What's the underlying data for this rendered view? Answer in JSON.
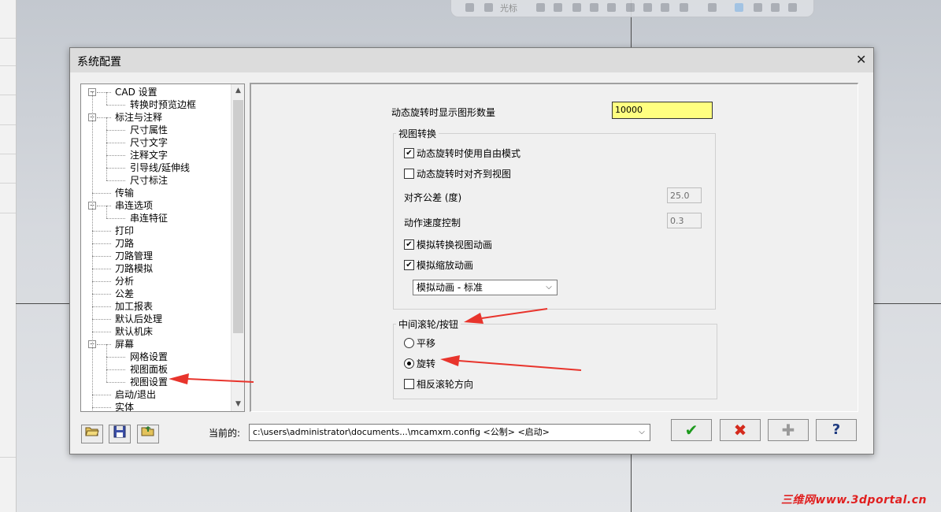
{
  "dialog": {
    "title": "系统配置",
    "close_symbol": "✕"
  },
  "tree": {
    "items": [
      {
        "label": "CAD 设置",
        "level": 0,
        "expander": "−"
      },
      {
        "label": "转换时预览边框",
        "level": 1
      },
      {
        "label": "标注与注释",
        "level": 0,
        "expander": "−"
      },
      {
        "label": "尺寸属性",
        "level": 1
      },
      {
        "label": "尺寸文字",
        "level": 1
      },
      {
        "label": "注释文字",
        "level": 1
      },
      {
        "label": "引导线/延伸线",
        "level": 1
      },
      {
        "label": "尺寸标注",
        "level": 1
      },
      {
        "label": "传输",
        "level": 0
      },
      {
        "label": "串连选项",
        "level": 0,
        "expander": "−"
      },
      {
        "label": "串连特征",
        "level": 1
      },
      {
        "label": "打印",
        "level": 0
      },
      {
        "label": "刀路",
        "level": 0
      },
      {
        "label": "刀路管理",
        "level": 0
      },
      {
        "label": "刀路模拟",
        "level": 0
      },
      {
        "label": "分析",
        "level": 0
      },
      {
        "label": "公差",
        "level": 0
      },
      {
        "label": "加工报表",
        "level": 0
      },
      {
        "label": "默认后处理",
        "level": 0
      },
      {
        "label": "默认机床",
        "level": 0
      },
      {
        "label": "屏幕",
        "level": 0,
        "expander": "−"
      },
      {
        "label": "网格设置",
        "level": 1
      },
      {
        "label": "视图面板",
        "level": 1
      },
      {
        "label": "视图设置",
        "level": 1
      },
      {
        "label": "启动/退出",
        "level": 0
      },
      {
        "label": "实体",
        "level": 0
      }
    ],
    "scroll_up": "▲",
    "scroll_down": "▼"
  },
  "settings": {
    "dynamic_count_label": "动态旋转时显示图形数量",
    "dynamic_count_value": "10000",
    "view_group": {
      "title": "视图转换",
      "free_mode_label": "动态旋转时使用自由模式",
      "free_mode_checked": true,
      "align_view_label": "动态旋转时对齐到视图",
      "align_view_checked": false,
      "align_tolerance_label": "对齐公差 (度)",
      "align_tolerance_value": "25.0",
      "speed_label": "动作速度控制",
      "speed_value": "0.3",
      "anim_view_label": "模拟转换视图动画",
      "anim_view_checked": true,
      "anim_zoom_label": "模拟缩放动画",
      "anim_zoom_checked": true,
      "anim_select_value": "模拟动画 - 标准"
    },
    "wheel_group": {
      "title": "中间滚轮/按钮",
      "pan_label": "平移",
      "rotate_label": "旋转",
      "selected": "rotate",
      "reverse_label": "相反滚轮方向",
      "reverse_checked": false
    }
  },
  "bottom": {
    "current_label": "当前的:",
    "current_path": "c:\\users\\administrator\\documents...\\mcamxm.config <公制> <启动>",
    "ok_symbol": "✔",
    "cancel_symbol": "✖",
    "add_symbol": "✚",
    "help_symbol": "?",
    "ok_color": "#1e9a1e",
    "cancel_color": "#d42a1c"
  },
  "background": {
    "toolbar_label": "光标",
    "watermark": "三维网www.3dportal.cn"
  },
  "annotations": {
    "arrow_color": "#e8342c"
  }
}
